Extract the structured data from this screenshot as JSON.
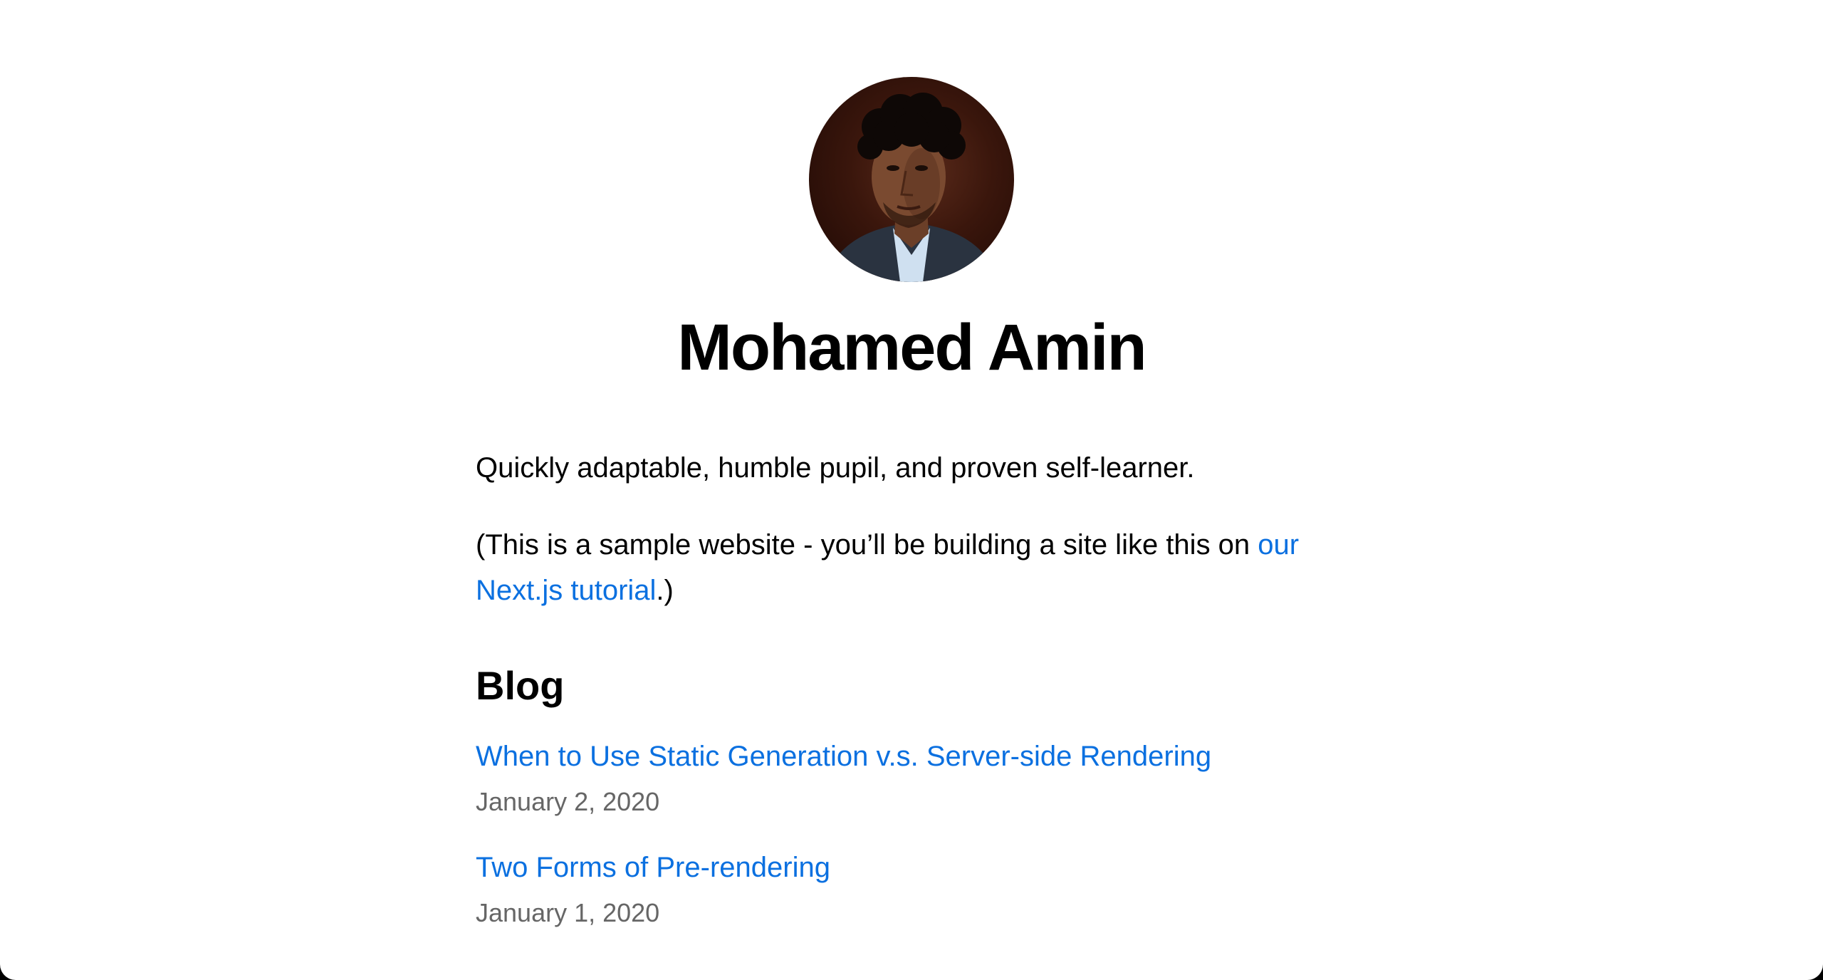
{
  "profile": {
    "name": "Mohamed Amin",
    "bio": "Quickly adaptable, humble pupil, and proven self-learner.",
    "note_prefix": "(This is a sample website - you’ll be building a site like this on ",
    "note_link": "our Next.js tutorial",
    "note_suffix": ".)"
  },
  "blog": {
    "heading": "Blog",
    "posts": [
      {
        "title": "When to Use Static Generation v.s. Server-side Rendering",
        "date": "January 2, 2020"
      },
      {
        "title": "Two Forms of Pre-rendering",
        "date": "January 1, 2020"
      }
    ]
  },
  "colors": {
    "link": "#0b70e0",
    "date": "#666666"
  }
}
